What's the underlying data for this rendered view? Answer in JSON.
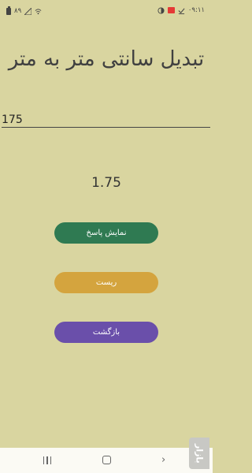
{
  "status_bar": {
    "battery_level": "٨٩",
    "time": "۰۹:۱۱"
  },
  "title": "تبدیل سانتی متر به متر",
  "input": {
    "value": "175",
    "placeholder": ""
  },
  "result": "1.75",
  "buttons": {
    "show": "نمایش پاسخ",
    "reset": "ریست",
    "back": "بازگشت"
  },
  "watermark": "بازار",
  "colors": {
    "background": "#d9d5a0",
    "show_button": "#2f7a52",
    "reset_button": "#d4a43e",
    "back_button": "#6a4faa"
  }
}
